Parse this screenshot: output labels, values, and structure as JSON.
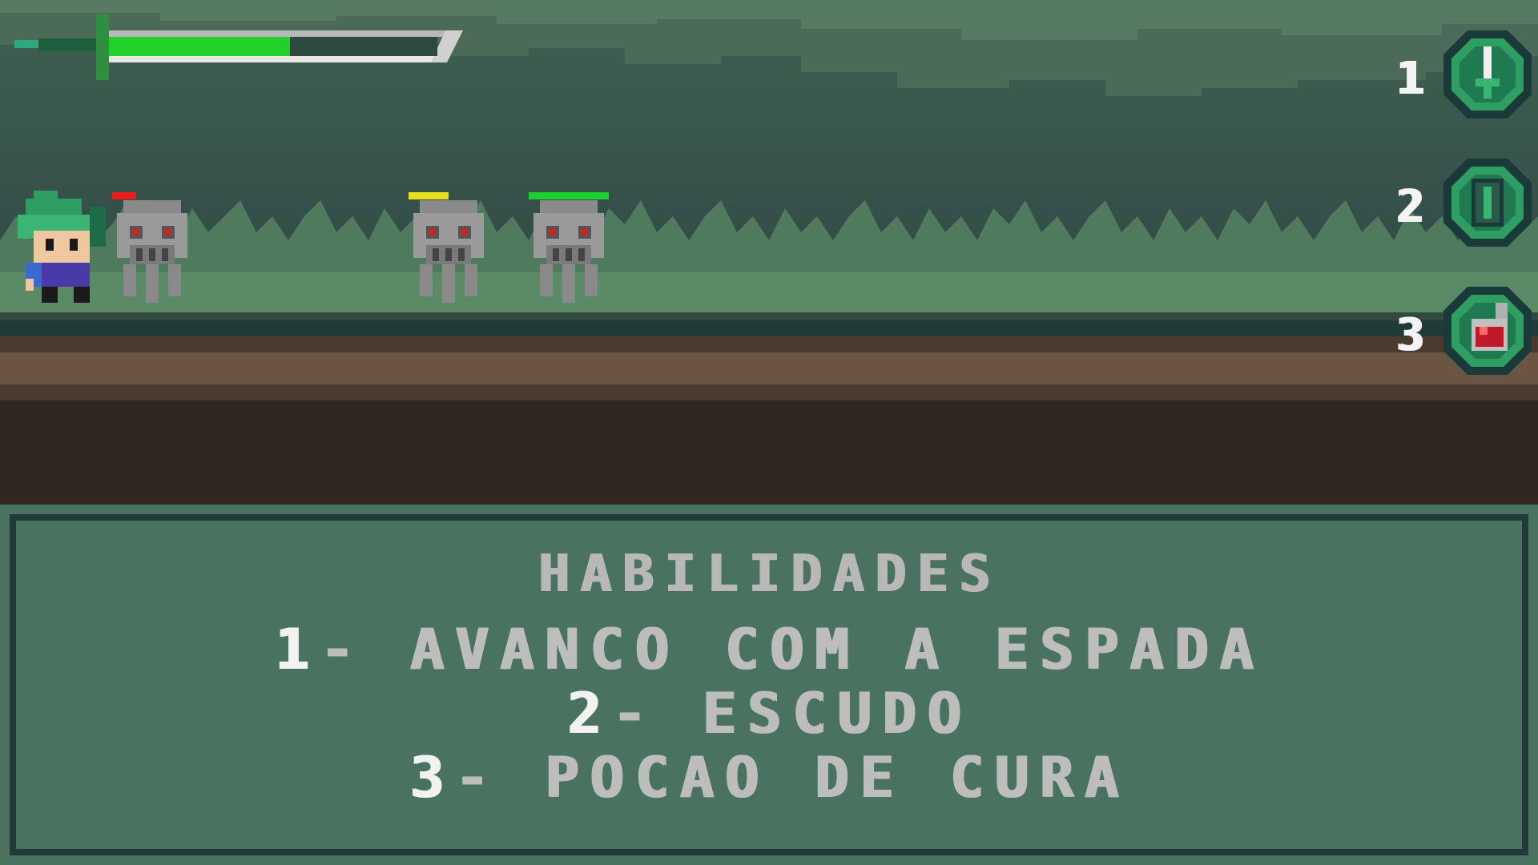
{
  "hud": {
    "health_fraction": 0.55,
    "health_color": "#22d02a",
    "icon": "sword-health-bar-icon"
  },
  "abilities_hotbar": [
    {
      "key": "1",
      "icon": "sword-dash-icon"
    },
    {
      "key": "2",
      "icon": "shield-icon"
    },
    {
      "key": "3",
      "icon": "healing-potion-icon"
    }
  ],
  "enemies": [
    {
      "icon": "skeleton-ghost-icon",
      "hp_color": "#e81c1c",
      "hp_fraction": 0.3
    },
    {
      "icon": "skeleton-ghost-icon",
      "hp_color": "#e8e01c",
      "hp_fraction": 0.5
    },
    {
      "icon": "skeleton-ghost-icon",
      "hp_color": "#1cd030",
      "hp_fraction": 1.0
    }
  ],
  "player": {
    "icon": "green-haired-hero-icon"
  },
  "panel": {
    "title": "HABILIDADES",
    "lines": [
      {
        "num": "1",
        "text": "- AVANCO COM A ESPADA"
      },
      {
        "num": "2",
        "text": "- ESCUDO"
      },
      {
        "num": "3",
        "text": "- POCAO DE CURA"
      }
    ]
  }
}
